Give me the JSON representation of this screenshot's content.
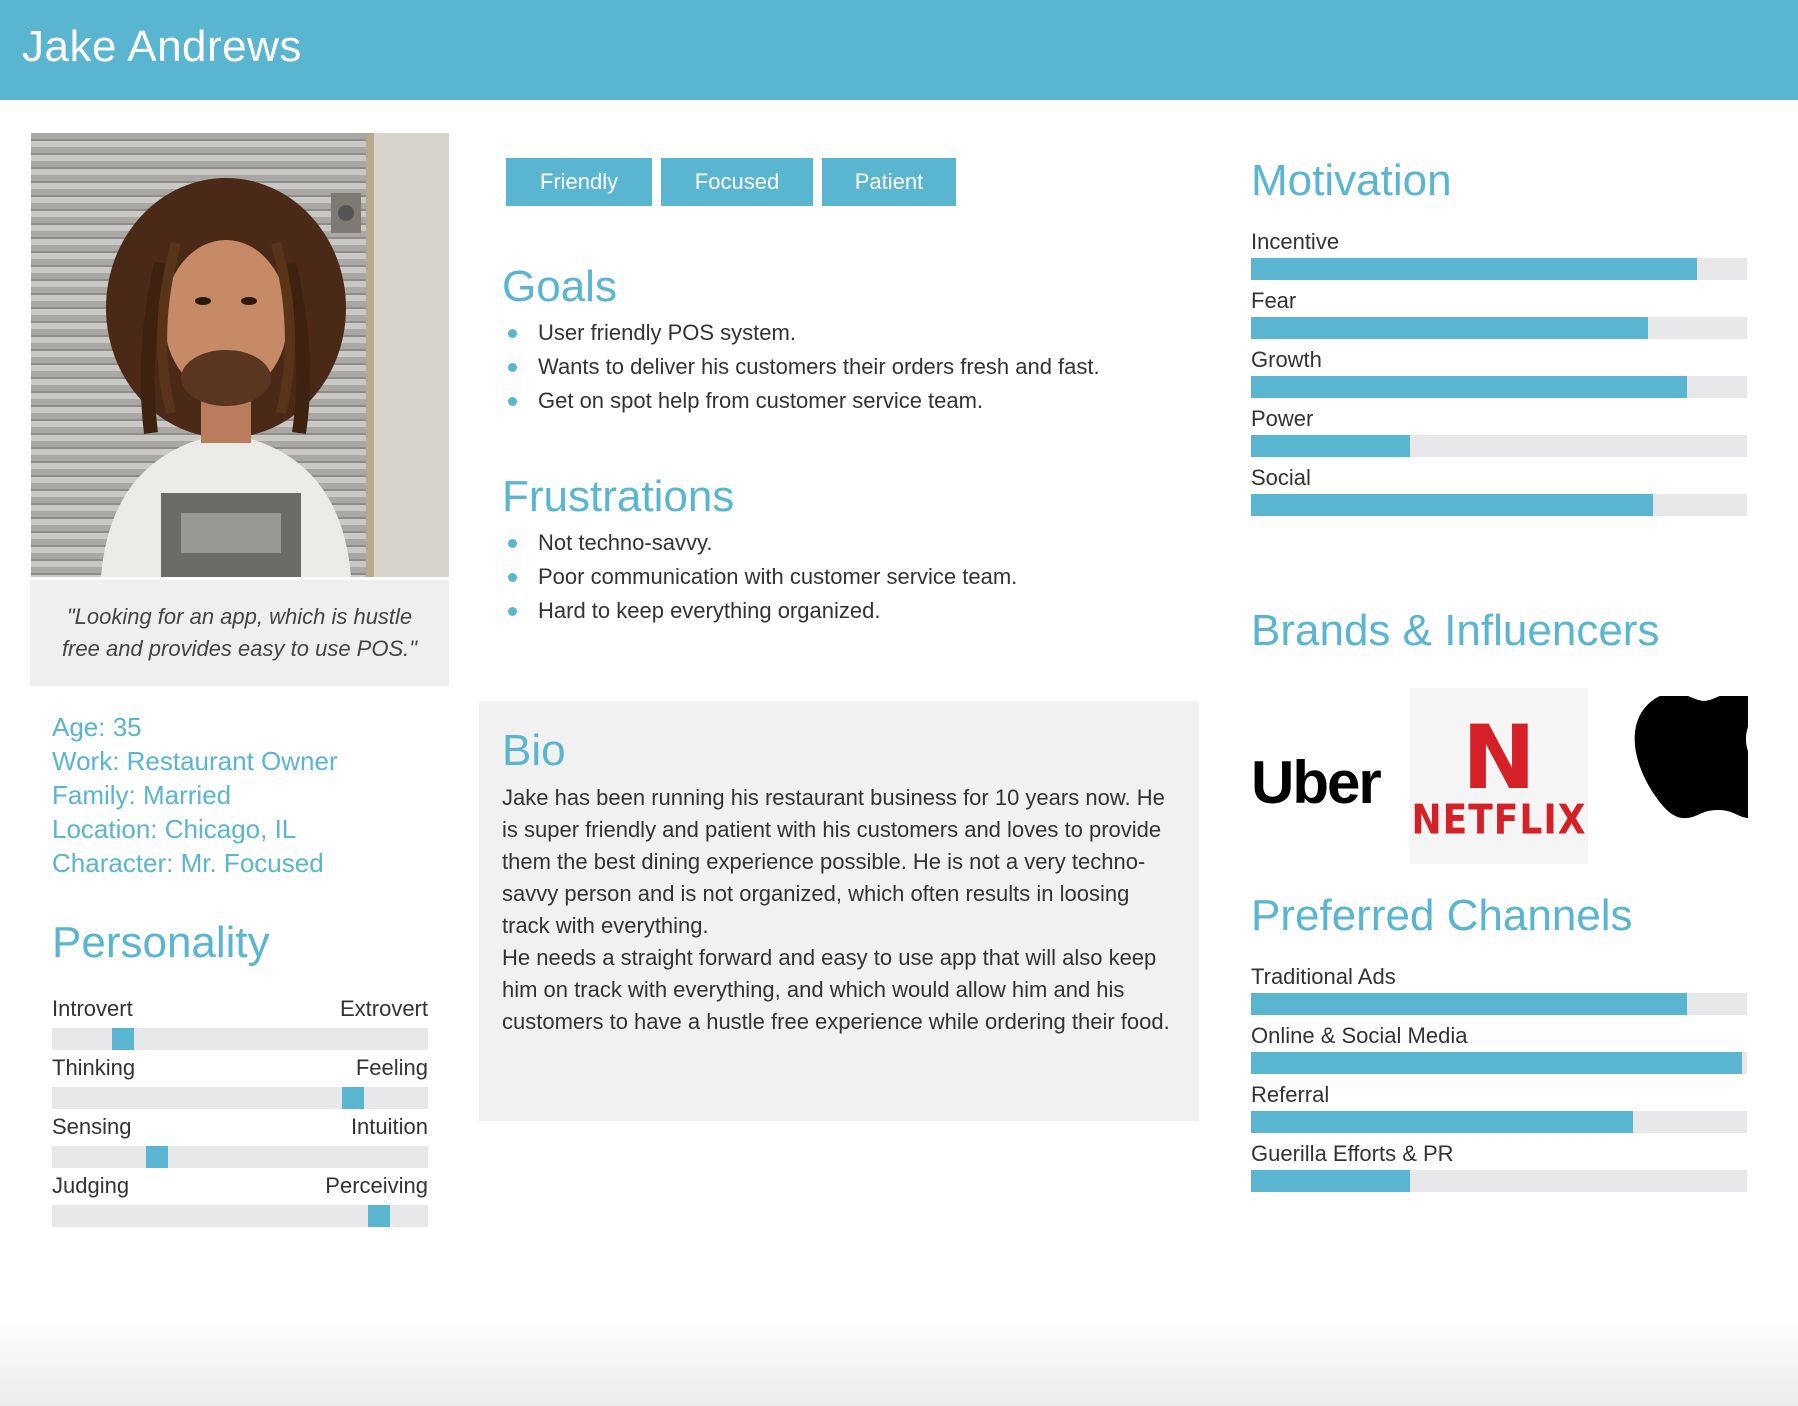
{
  "persona": {
    "name": "Jake Andrews",
    "quote": "\"Looking for an app, which is hustle free and provides easy to use POS.\"",
    "facts": [
      {
        "label": "Age: 35"
      },
      {
        "label": "Work: Restaurant Owner"
      },
      {
        "label": "Family: Married"
      },
      {
        "label": "Location: Chicago, IL"
      },
      {
        "label": "Character: Mr. Focused"
      }
    ],
    "tags": [
      "Friendly",
      "Focused",
      "Patient"
    ]
  },
  "personality": {
    "title": "Personality",
    "traits": [
      {
        "left": "Introvert",
        "right": "Extrovert",
        "value": 0.19
      },
      {
        "left": "Thinking",
        "right": "Feeling",
        "value": 0.8
      },
      {
        "left": "Sensing",
        "right": "Intuition",
        "value": 0.28
      },
      {
        "left": "Judging",
        "right": "Perceiving",
        "value": 0.87
      }
    ]
  },
  "goals": {
    "title": "Goals",
    "items": [
      "User friendly POS system.",
      "Wants to deliver his customers their orders fresh and fast.",
      "Get on spot help from customer service team."
    ]
  },
  "frustrations": {
    "title": "Frustrations",
    "items": [
      "Not techno-savvy.",
      "Poor communication with customer service team.",
      "Hard to keep everything organized."
    ]
  },
  "bio": {
    "title": "Bio",
    "paragraphs": [
      "Jake has been running his restaurant business for 10 years now. He is super friendly and patient with his customers and loves to provide them the best dining experience possible. He is not a very techno-savvy person and is not organized, which often results in loosing track with everything.",
      "He needs a straight forward and easy to use app that will also keep him on track with everything, and which would allow him and his customers to have a hustle free experience while ordering their food."
    ]
  },
  "motivation": {
    "title": "Motivation",
    "items": [
      {
        "label": "Incentive",
        "value": 0.9
      },
      {
        "label": "Fear",
        "value": 0.8
      },
      {
        "label": "Growth",
        "value": 0.88
      },
      {
        "label": "Power",
        "value": 0.32
      },
      {
        "label": "Social",
        "value": 0.81
      }
    ]
  },
  "brands": {
    "title": "Brands & Influencers",
    "logos": [
      {
        "name": "Uber",
        "text": "Uber"
      },
      {
        "name": "Netflix",
        "text": "NETFLIX",
        "mark": "N"
      },
      {
        "name": "Apple",
        "icon": "apple-logo"
      }
    ]
  },
  "channels": {
    "title": "Preferred Channels",
    "items": [
      {
        "label": "Traditional Ads",
        "value": 0.88
      },
      {
        "label": "Online & Social Media",
        "value": 0.99
      },
      {
        "label": "Referral",
        "value": 0.77
      },
      {
        "label": "Guerilla Efforts & PR",
        "value": 0.32
      }
    ]
  },
  "colors": {
    "accent": "#5ab5d1",
    "track": "#e8e8ea",
    "panel": "#f1f1f2",
    "netflix": "#d32127"
  }
}
